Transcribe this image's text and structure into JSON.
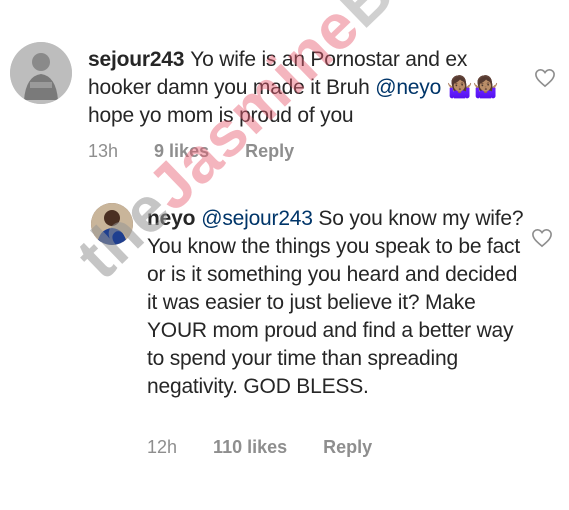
{
  "comments": [
    {
      "username": "sejour243",
      "text_before": "Yo wife  is an Pornostar and ex hooker damn you made it Bruh ",
      "mention": "@neyo",
      "text_after": " 🤷🏽‍♀️🤷🏽‍♀️ hope yo mom is proud of you",
      "time": "13h",
      "likes": "9 likes",
      "reply": "Reply",
      "avatar_icon": "profile-photo-statue"
    },
    {
      "username": "neyo",
      "mention": "@sejour243",
      "text": " So you know my wife? You know the things you speak to be fact or is it something you heard and decided it was easier to just believe it? Make YOUR mom proud and find a better way to spend your time than spreading negativity. GOD BLESS.",
      "time": "12h",
      "likes": "110 likes",
      "reply": "Reply",
      "avatar_icon": "profile-photo-man"
    }
  ],
  "watermark": {
    "part1": "the",
    "part2": "Jasmine",
    "part3": "BRAND"
  },
  "colors": {
    "text": "#262626",
    "meta": "#8e8e8e",
    "mention": "#003569",
    "watermark_accent": "#e65a6e"
  }
}
